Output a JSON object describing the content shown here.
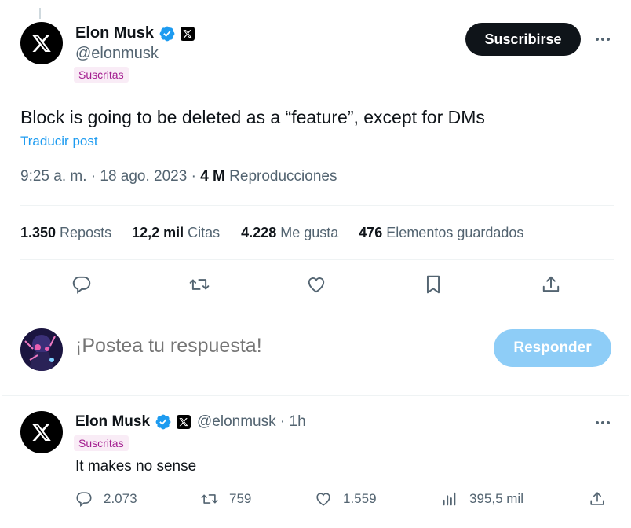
{
  "tweet": {
    "author_name": "Elon Musk",
    "handle": "@elonmusk",
    "subscribed_label": "Suscritas",
    "follow_label": "Suscribirse",
    "text": "Block is going to be deleted as a “feature”, except for DMs",
    "translate_label": "Traducir post",
    "time": "9:25 a. m. · 18 ago. 2023 · ",
    "views_count": "4 M",
    "views_label": " Reproducciones",
    "stats": [
      {
        "count": "1.350",
        "label": " Reposts"
      },
      {
        "count": "12,2 mil",
        "label": " Citas"
      },
      {
        "count": "4.228",
        "label": " Me gusta"
      },
      {
        "count": "476",
        "label": " Elementos guardados"
      }
    ]
  },
  "compose": {
    "placeholder": "¡Postea tu respuesta!",
    "reply_button": "Responder"
  },
  "reply": {
    "author_name": "Elon Musk",
    "handle": "@elonmusk · 1h",
    "subscribed_label": "Suscritas",
    "text": "It makes no sense",
    "replies": "2.073",
    "reposts": "759",
    "likes": "1.559",
    "views": "395,5 mil"
  },
  "icons": {
    "verified": "verified-badge-icon",
    "x_logo": "x-logo-icon",
    "more": "more-icon",
    "reply": "reply-icon",
    "repost": "repost-icon",
    "like": "heart-icon",
    "bookmark": "bookmark-icon",
    "share": "share-icon",
    "views": "views-icon"
  },
  "colors": {
    "accent": "#1d9bf0",
    "subscribed_bg": "#f9ecf6",
    "subscribed_text": "#a31d8f",
    "reply_button_disabled": "#8ecdf7"
  }
}
